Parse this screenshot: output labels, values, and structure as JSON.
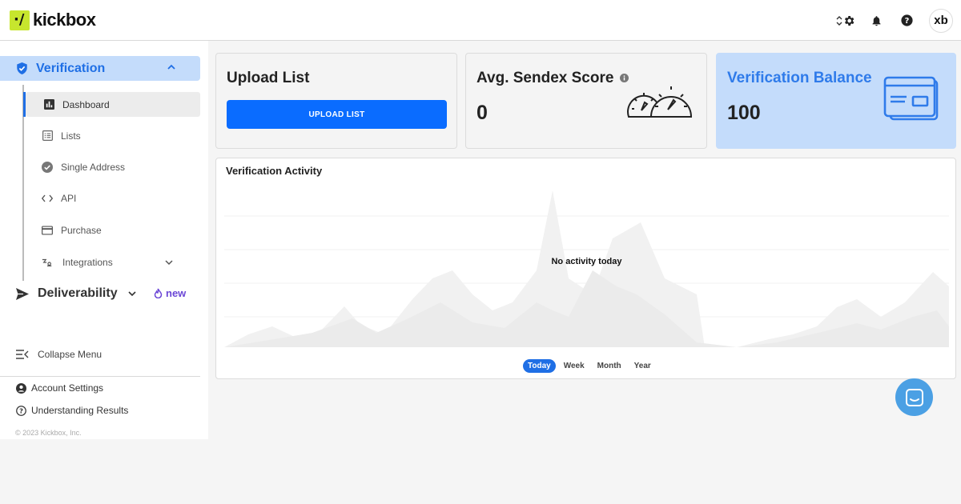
{
  "brand": {
    "logo_mark": "·/",
    "logo_text": "kickbox"
  },
  "header": {
    "icons": [
      "sort-icon",
      "gear-icon",
      "bell-icon",
      "help-icon"
    ],
    "avatar_text": "xb"
  },
  "sidebar": {
    "section": "Verification",
    "items": [
      {
        "label": "Dashboard",
        "icon": "bar-chart-icon",
        "active": true
      },
      {
        "label": "Lists",
        "icon": "list-icon"
      },
      {
        "label": "Single Address",
        "icon": "check-circle-icon"
      },
      {
        "label": "API",
        "icon": "code-icon"
      },
      {
        "label": "Purchase",
        "icon": "credit-card-icon"
      },
      {
        "label": "Integrations",
        "icon": "integrations-icon"
      }
    ],
    "deliverability": "Deliverability",
    "new_badge": "new",
    "collapse": "Collapse Menu",
    "account_settings": "Account Settings",
    "understanding_results": "Understanding Results",
    "copyright": "© 2023 Kickbox, Inc."
  },
  "cards": {
    "upload": {
      "title": "Upload List",
      "button": "UPLOAD LIST"
    },
    "sendex": {
      "title": "Avg. Sendex Score",
      "value": "0"
    },
    "balance": {
      "title": "Verification Balance",
      "value": "100"
    }
  },
  "activity": {
    "title": "Verification Activity",
    "empty_message": "No activity today",
    "periods": [
      "Today",
      "Week",
      "Month",
      "Year"
    ],
    "selected_period": "Today"
  },
  "colors": {
    "accent": "#1f6fe5",
    "accent_light": "#c4dcfb",
    "brand_green": "#c7e62e",
    "new_purple": "#6b47d6",
    "chat": "#4ba0e4"
  }
}
